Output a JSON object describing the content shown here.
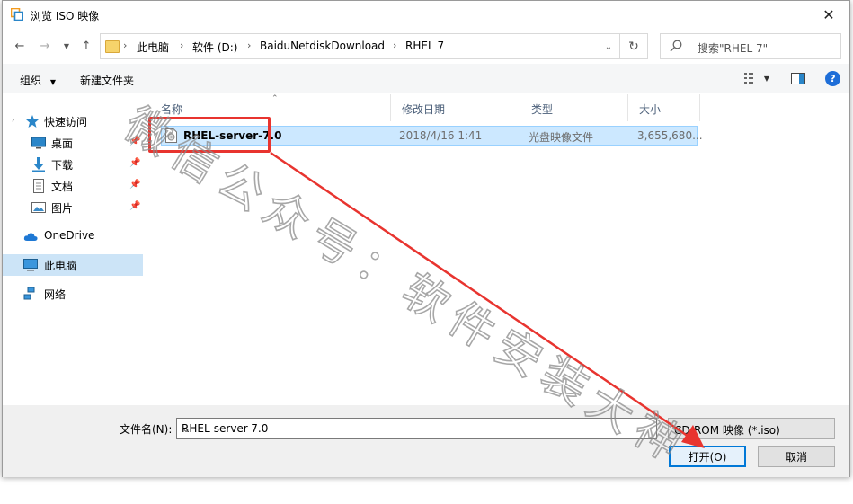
{
  "window": {
    "title": "浏览 ISO 映像"
  },
  "nav": {
    "breadcrumbs": [
      "此电脑",
      "软件 (D:)",
      "BaiduNetdiskDownload",
      "RHEL 7"
    ],
    "search_placeholder": "搜索\"RHEL 7\""
  },
  "toolbar": {
    "organize": "组织",
    "new_folder": "新建文件夹"
  },
  "sidebar": {
    "items": [
      {
        "label": "快速访问",
        "icon": "star-icon"
      },
      {
        "label": "桌面",
        "icon": "desktop-icon",
        "pinned": true
      },
      {
        "label": "下载",
        "icon": "download-icon",
        "pinned": true
      },
      {
        "label": "文档",
        "icon": "document-icon",
        "pinned": true
      },
      {
        "label": "图片",
        "icon": "picture-icon",
        "pinned": true
      },
      {
        "label": "OneDrive",
        "icon": "cloud-icon"
      },
      {
        "label": "此电脑",
        "icon": "computer-icon",
        "selected": true
      },
      {
        "label": "网络",
        "icon": "network-icon"
      }
    ]
  },
  "columns": {
    "name": "名称",
    "date": "修改日期",
    "type": "类型",
    "size": "大小"
  },
  "files": [
    {
      "name": "RHEL-server-7.0",
      "date": "2018/4/16 1:41",
      "type": "光盘映像文件",
      "size": "3,655,680..."
    }
  ],
  "bottom": {
    "filename_label": "文件名(N):",
    "filename_value": "RHEL-server-7.0",
    "filetype_value": "CD-ROM 映像 (*.iso)",
    "open_label": "打开(O)",
    "cancel_label": "取消"
  },
  "watermark": "微信公众号：软件安装大神",
  "colors": {
    "selection": "#cce8ff",
    "annotation": "#e8342f",
    "accent": "#0078d7"
  }
}
